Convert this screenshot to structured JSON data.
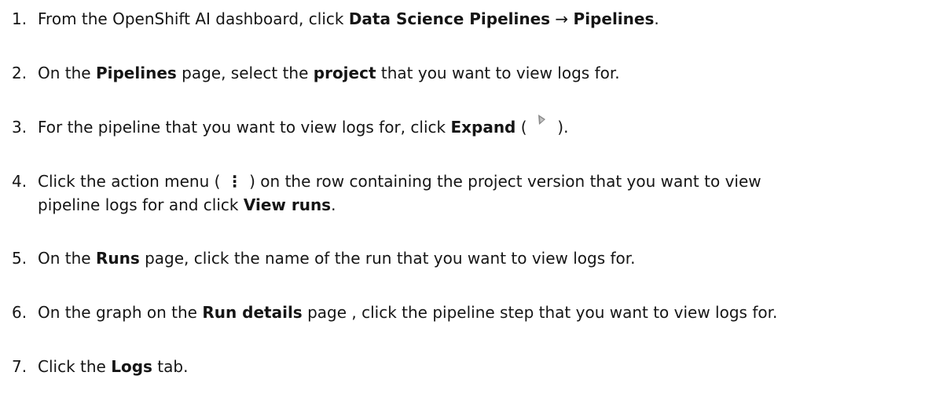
{
  "steps": [
    {
      "number": "1.",
      "parts": [
        "From the OpenShift AI dashboard, click ",
        "Data Science Pipelines",
        " → ",
        "Pipelines",
        "."
      ]
    },
    {
      "number": "2.",
      "parts": [
        "On the ",
        "Pipelines",
        " page, select the ",
        "project",
        " that you want to view logs for."
      ]
    },
    {
      "number": "3.",
      "parts": [
        "For the pipeline that you want to view logs for, click ",
        "Expand",
        " ( ",
        " )."
      ],
      "icon": "expand-chevron-icon"
    },
    {
      "number": "4.",
      "parts": [
        "Click the action menu ( ",
        "⋮",
        " ) on the row containing the project version that you want to view"
      ],
      "continuation": [
        "pipeline logs for and click ",
        "View runs",
        "."
      ],
      "icon": "kebab-menu-icon"
    },
    {
      "number": "5.",
      "parts": [
        "On the ",
        "Runs",
        " page, click the name of the run that you want to view logs for."
      ]
    },
    {
      "number": "6.",
      "parts": [
        "On the graph on the ",
        "Run details",
        " page , click the pipeline step that you want to view logs for."
      ]
    },
    {
      "number": "7.",
      "parts": [
        "Click the ",
        "Logs",
        " tab."
      ]
    }
  ]
}
